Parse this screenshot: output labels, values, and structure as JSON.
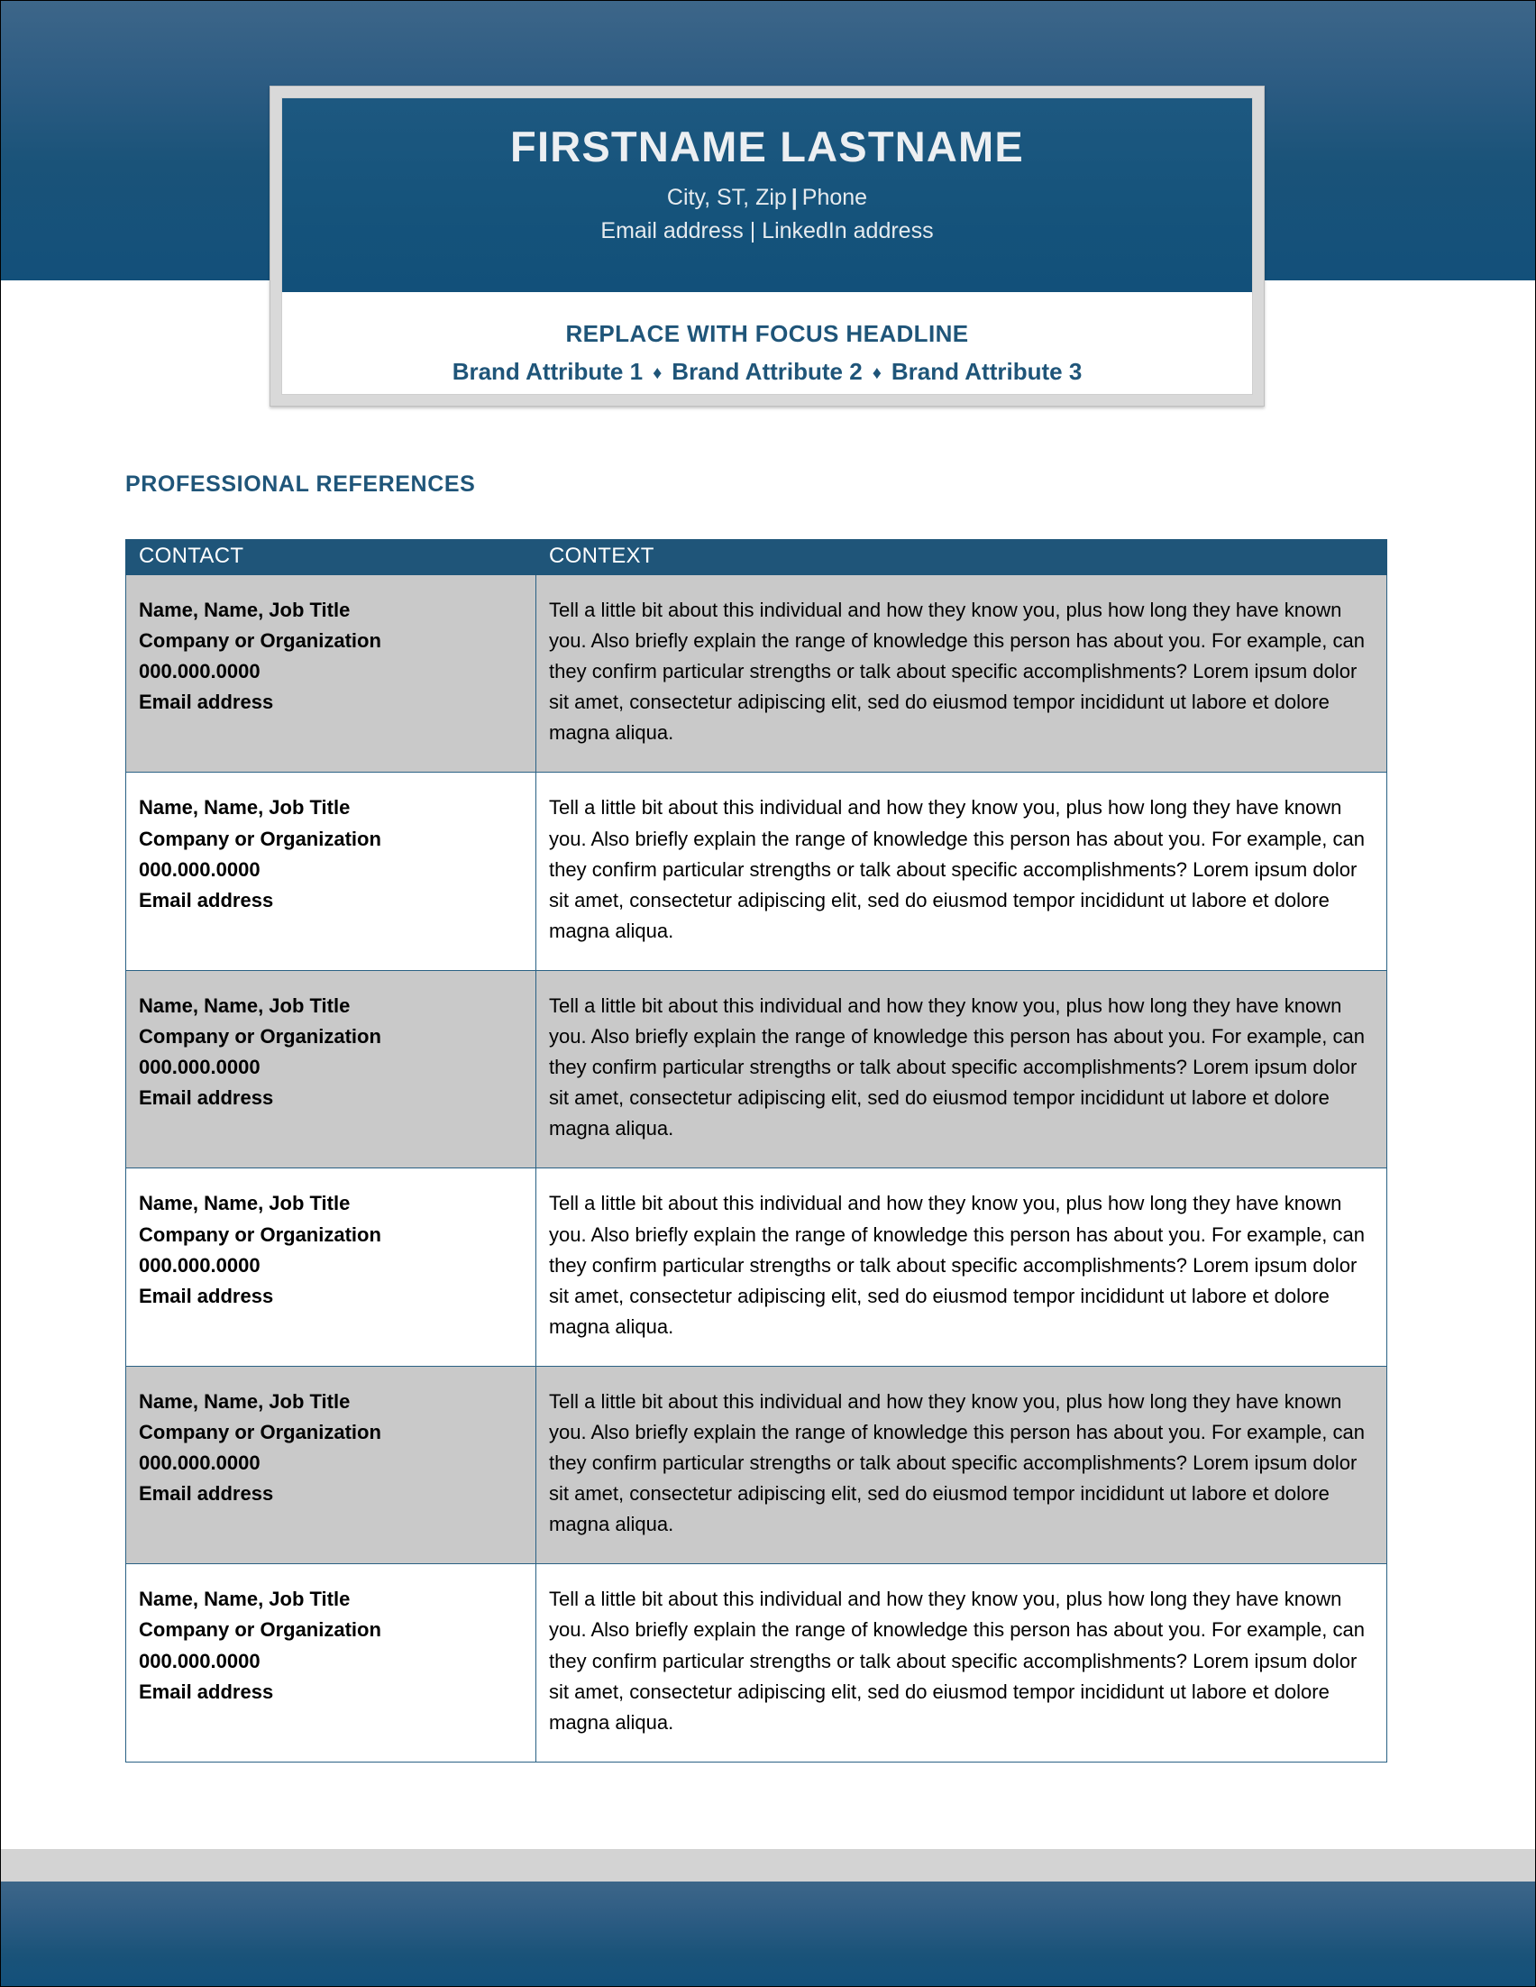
{
  "document": {
    "type": "resume-professional-references-page"
  },
  "header": {
    "full_name": "FIRSTNAME LASTNAME",
    "location": "City, ST, Zip",
    "separator": "|",
    "phone": "Phone",
    "email": "Email address",
    "linkedin": "LinkedIn address",
    "contact_line_2": "Email address | LinkedIn address",
    "focus_headline": "REPLACE WITH FOCUS HEADLINE",
    "brand_attribute_1": "Brand Attribute 1",
    "brand_attribute_2": "Brand Attribute 2",
    "brand_attribute_3": "Brand Attribute 3",
    "bullet_glyph": "♦"
  },
  "section": {
    "title": "PROFESSIONAL REFERENCES"
  },
  "table": {
    "columns": [
      "CONTACT",
      "CONTEXT"
    ],
    "header_contact": "CONTACT",
    "header_context": "CONTEXT",
    "rows": [
      {
        "shaded": true,
        "name_title": "Name, Name, Job Title",
        "company": "Company or Organization",
        "phone": "000.000.0000",
        "email": "Email address",
        "context": "Tell a little bit about this individual and how they know you, plus how long they have known you. Also briefly explain the range of knowledge this person has about you. For example, can they confirm particular strengths or talk about specific accomplishments? Lorem ipsum dolor sit amet, consectetur adipiscing elit, sed do eiusmod tempor incididunt ut labore et dolore magna aliqua."
      },
      {
        "shaded": false,
        "name_title": "Name, Name, Job Title",
        "company": "Company or Organization",
        "phone": "000.000.0000",
        "email": "Email address",
        "context": "Tell a little bit about this individual and how they know you, plus how long they have known you. Also briefly explain the range of knowledge this person has about you. For example, can they confirm particular strengths or talk about specific accomplishments? Lorem ipsum dolor sit amet, consectetur adipiscing elit, sed do eiusmod tempor incididunt ut labore et dolore magna aliqua."
      },
      {
        "shaded": true,
        "name_title": "Name, Name, Job Title",
        "company": "Company or Organization",
        "phone": "000.000.0000",
        "email": "Email address",
        "context": "Tell a little bit about this individual and how they know you, plus how long they have known you. Also briefly explain the range of knowledge this person has about you. For example, can they confirm particular strengths or talk about specific accomplishments? Lorem ipsum dolor sit amet, consectetur adipiscing elit, sed do eiusmod tempor incididunt ut labore et dolore magna aliqua."
      },
      {
        "shaded": false,
        "name_title": "Name, Name, Job Title",
        "company": "Company or Organization",
        "phone": "000.000.0000",
        "email": "Email address",
        "context": "Tell a little bit about this individual and how they know you, plus how long they have known you. Also briefly explain the range of knowledge this person has about you. For example, can they confirm particular strengths or talk about specific accomplishments? Lorem ipsum dolor sit amet, consectetur adipiscing elit, sed do eiusmod tempor incididunt ut labore et dolore magna aliqua."
      },
      {
        "shaded": true,
        "name_title": "Name, Name, Job Title",
        "company": "Company or Organization",
        "phone": "000.000.0000",
        "email": "Email address",
        "context": "Tell a little bit about this individual and how they know you, plus how long they have known you. Also briefly explain the range of knowledge this person has about you. For example, can they confirm particular strengths or talk about specific accomplishments? Lorem ipsum dolor sit amet, consectetur adipiscing elit, sed do eiusmod tempor incididunt ut labore et dolore magna aliqua."
      },
      {
        "shaded": false,
        "name_title": "Name, Name, Job Title",
        "company": "Company or Organization",
        "phone": "000.000.0000",
        "email": "Email address",
        "context": "Tell a little bit about this individual and how they know you, plus how long they have known you. Also briefly explain the range of knowledge this person has about you. For example, can they confirm particular strengths or talk about specific accomplishments? Lorem ipsum dolor sit amet, consectetur adipiscing elit, sed do eiusmod tempor incididunt ut labore et dolore magna aliqua."
      }
    ]
  },
  "colors": {
    "brand_blue": "#1f5579",
    "banner_blue_top": "#3d6689",
    "banner_blue_bottom": "#13507a",
    "shaded_row": "#c9c9c9",
    "frame_gray": "#d9d9d9",
    "footer_gray": "#d3d3d3"
  }
}
